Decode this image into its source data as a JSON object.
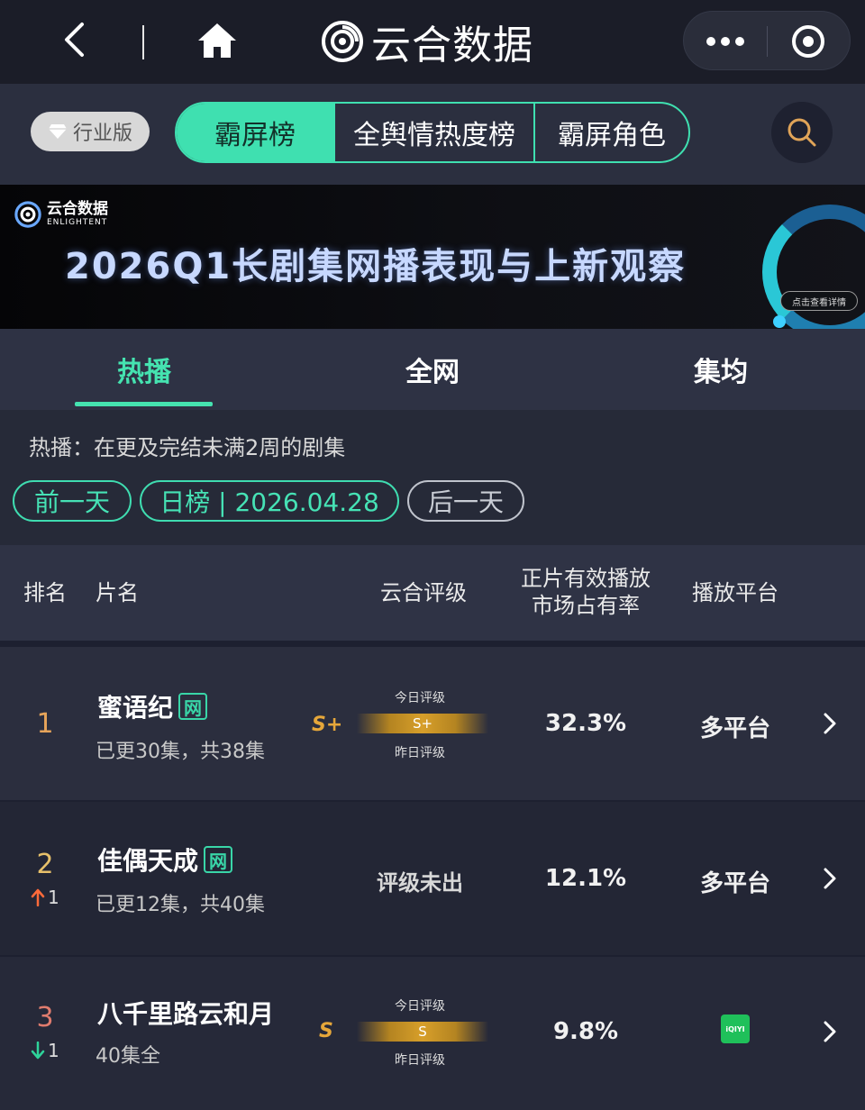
{
  "topbar": {
    "brand": "云合数据",
    "icons": {
      "back": "chevron-left-icon",
      "home": "home-icon",
      "more": "more-icon",
      "close": "target-icon"
    }
  },
  "nav": {
    "industry_badge": "行业版",
    "segments": [
      "霸屏榜",
      "全舆情热度榜",
      "霸屏角色"
    ],
    "active_segment": "霸屏榜",
    "accent_color": "#3fe0b0"
  },
  "banner": {
    "logo_cn": "云合数据",
    "logo_en": "ENLIGHTENT",
    "title": "2026Q1长剧集网播表现与上新观察",
    "detail_button": "点击查看详情"
  },
  "tabs": [
    "热播",
    "全网",
    "集均"
  ],
  "active_tab": "热播",
  "filter": {
    "description": "热播：在更及完结未满2周的剧集",
    "prev_day": "前一天",
    "current": "日榜 | 2026.04.28",
    "next_day": "后一天"
  },
  "table": {
    "headers": {
      "rank": "排名",
      "title": "片名",
      "grade": "云合评级",
      "share_line1": "正片有效播放",
      "share_line2": "市场占有率",
      "platform": "播放平台"
    },
    "rows": [
      {
        "rank": "1",
        "title": "蜜语纪",
        "badge": "网",
        "episodes": "已更30集，共38集",
        "grade_yesterday": "S+",
        "grade_today": "S+",
        "grade_today_label": "今日评级",
        "grade_yesterday_label": "昨日评级",
        "share": "32.3%",
        "platform": "多平台"
      },
      {
        "rank": "2",
        "rank_change": "1",
        "rank_dir": "up",
        "title": "佳偶天成",
        "badge": "网",
        "episodes": "已更12集，共40集",
        "grade_none": "评级未出",
        "share": "12.1%",
        "platform": "多平台"
      },
      {
        "rank": "3",
        "rank_change": "1",
        "rank_dir": "down",
        "title": "八千里路云和月",
        "episodes": "40集全",
        "grade_yesterday": "S",
        "grade_today": "S",
        "grade_today_label": "今日评级",
        "grade_yesterday_label": "昨日评级",
        "share": "9.8%",
        "platform_logo": "iQIYI"
      }
    ]
  }
}
